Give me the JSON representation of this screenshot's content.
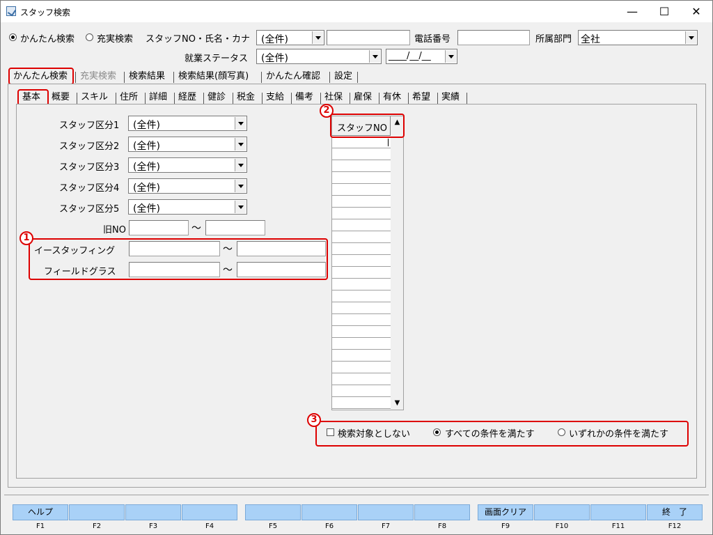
{
  "window": {
    "title": "スタッフ検索",
    "minimize": "—",
    "maximize": "☐",
    "close": "✕"
  },
  "top": {
    "mode_simple": "かんたん検索",
    "mode_full": "充実検索",
    "staff_search_label": "スタッフNO・氏名・カナ",
    "staff_search_combo": "(全件)",
    "staff_search_value": "",
    "phone_label": "電話番号",
    "phone_value": "",
    "dept_label": "所属部門",
    "dept_value": "全社",
    "status_label": "就業ステータス",
    "status_value": "(全件)",
    "date_value": "____/__/__"
  },
  "main_tabs": [
    "かんたん検索",
    "充実検索",
    "検索結果",
    "検索結果(顔写真)",
    "かんたん確認",
    "設定"
  ],
  "sub_tabs": [
    "基本",
    "概要",
    "スキル",
    "住所",
    "詳細",
    "経歴",
    "健診",
    "税金",
    "支給",
    "備考",
    "社保",
    "雇保",
    "有休",
    "希望",
    "実績"
  ],
  "form": {
    "kubun": [
      {
        "label": "スタッフ区分1",
        "value": "(全件)"
      },
      {
        "label": "スタッフ区分2",
        "value": "(全件)"
      },
      {
        "label": "スタッフ区分3",
        "value": "(全件)"
      },
      {
        "label": "スタッフ区分4",
        "value": "(全件)"
      },
      {
        "label": "スタッフ区分5",
        "value": "(全件)"
      }
    ],
    "old_no_label": "旧NO",
    "tilde": "〜",
    "estaffing_label": "イースタッフィング",
    "fieldglass_label": "フィールドグラス"
  },
  "grid": {
    "header": "スタッフNO"
  },
  "options": {
    "exclude_label": "検索対象としない",
    "all_label": "すべての条件を満たす",
    "any_label": "いずれかの条件を満たす"
  },
  "badges": [
    "1",
    "2",
    "3"
  ],
  "fkeys": [
    {
      "label": "ヘルプ",
      "key": "F1"
    },
    {
      "label": "",
      "key": "F2"
    },
    {
      "label": "",
      "key": "F3"
    },
    {
      "label": "",
      "key": "F4"
    },
    {
      "label": "",
      "key": "F5"
    },
    {
      "label": "",
      "key": "F6"
    },
    {
      "label": "",
      "key": "F7"
    },
    {
      "label": "",
      "key": "F8"
    },
    {
      "label": "画面クリア",
      "key": "F9"
    },
    {
      "label": "",
      "key": "F10"
    },
    {
      "label": "",
      "key": "F11"
    },
    {
      "label": "終　了",
      "key": "F12"
    }
  ]
}
